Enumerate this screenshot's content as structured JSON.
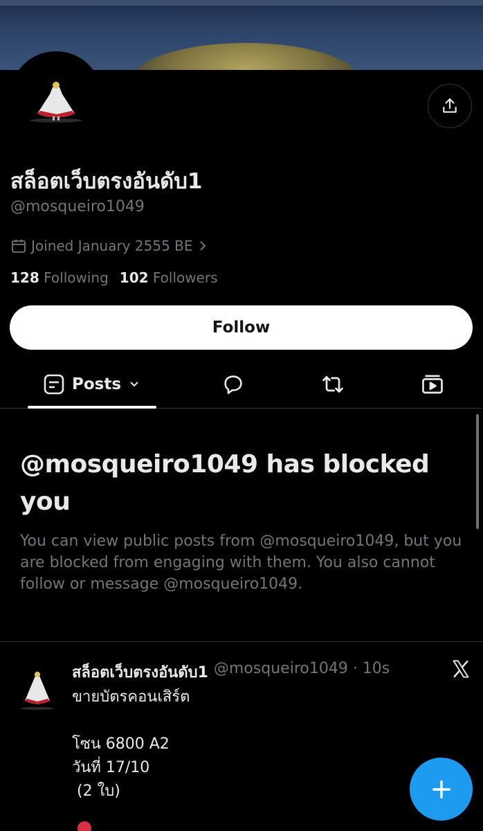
{
  "profile": {
    "display_name": "สล็อตเว็บตรงอันดับ1",
    "handle": "@mosqueiro1049",
    "joined": "Joined January 2555 BE",
    "following_count": "128",
    "following_label": "Following",
    "followers_count": "102",
    "followers_label": "Followers"
  },
  "actions": {
    "follow_label": "Follow",
    "share_icon": "share-icon"
  },
  "tabs": [
    {
      "label": "Posts",
      "icon": "posts-icon",
      "active": true
    },
    {
      "icon": "replies-icon"
    },
    {
      "icon": "reposts-icon"
    },
    {
      "icon": "media-icon"
    }
  ],
  "blocked": {
    "title": "@mosqueiro1049 has blocked you",
    "description": "You can view public posts from @mosqueiro1049, but you are blocked from engaging with them. You also cannot follow or message @mosqueiro1049."
  },
  "post": {
    "author": "สล็อตเว็บตรงอันดับ1",
    "handle_time": "@mosqueiro1049 · 10s",
    "body": "ขายบัตรคอนเสิร์ต\n\nโซน 6800 A2\nวันที่ 17/10\n (2 ใบ)"
  },
  "colors": {
    "background": "#000000",
    "text_primary": "#e7e9ea",
    "text_secondary": "#71767b",
    "accent": "#1d9bf0"
  }
}
